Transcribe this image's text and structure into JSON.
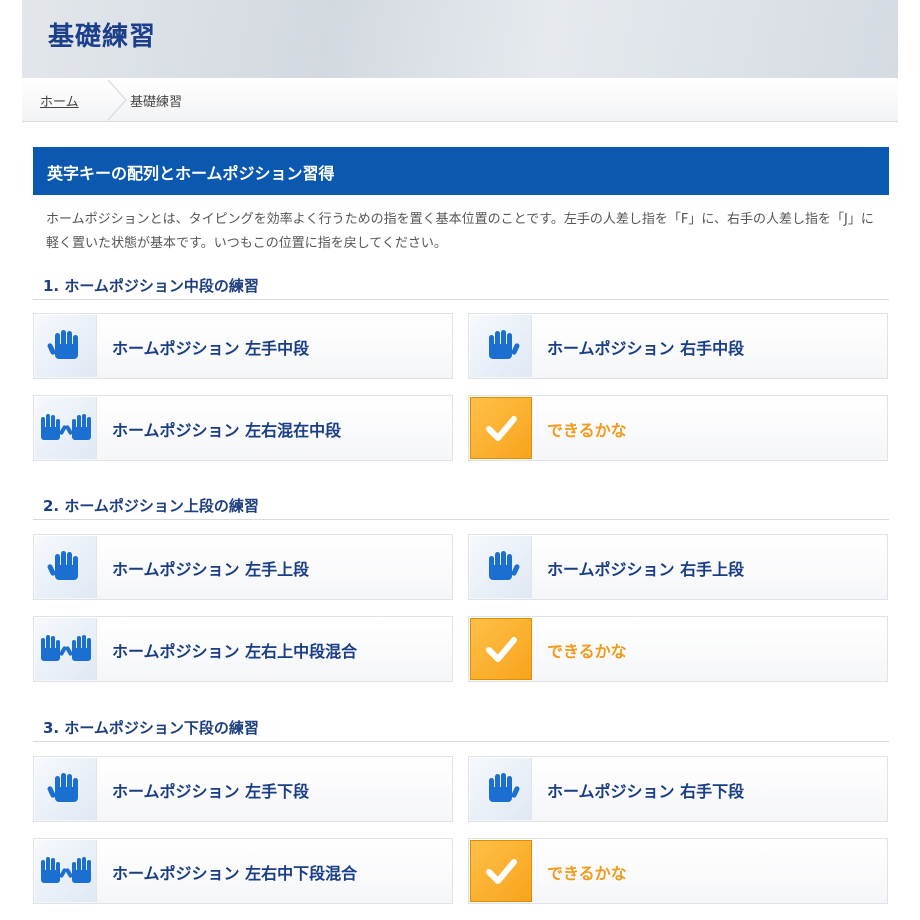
{
  "header": {
    "title": "基礎練習"
  },
  "breadcrumb": {
    "home": "ホーム",
    "current": "基礎練習"
  },
  "section": {
    "title": "英字キーの配列とホームポジション習得",
    "intro": "ホームポジションとは、タイピングを効率よく行うための指を置く基本位置のことです。左手の人差し指を「F」に、右手の人差し指を「J」に軽く置いた状態が基本です。いつもこの位置に指を戻してください。"
  },
  "groups": [
    {
      "heading": "1. ホームポジション中段の練習",
      "items": [
        {
          "label": "ホームポジション 左手中段",
          "icon": "left-hand-icon"
        },
        {
          "label": "ホームポジション 右手中段",
          "icon": "right-hand-icon"
        },
        {
          "label": "ホームポジション 左右混在中段",
          "icon": "both-hands-icon"
        },
        {
          "label": "できるかな",
          "icon": "checkmark-icon"
        }
      ]
    },
    {
      "heading": "2. ホームポジション上段の練習",
      "items": [
        {
          "label": "ホームポジション 左手上段",
          "icon": "left-hand-icon"
        },
        {
          "label": "ホームポジション 右手上段",
          "icon": "right-hand-icon"
        },
        {
          "label": "ホームポジション 左右上中段混合",
          "icon": "both-hands-icon"
        },
        {
          "label": "できるかな",
          "icon": "checkmark-icon"
        }
      ]
    },
    {
      "heading": "3. ホームポジション下段の練習",
      "items": [
        {
          "label": "ホームポジション 左手下段",
          "icon": "left-hand-icon"
        },
        {
          "label": "ホームポジション 右手下段",
          "icon": "right-hand-icon"
        },
        {
          "label": "ホームポジション 左右中下段混合",
          "icon": "both-hands-icon"
        },
        {
          "label": "できるかな",
          "icon": "checkmark-icon"
        }
      ]
    }
  ],
  "colors": {
    "header_title": "#1c3f8c",
    "section_bar": "#0a58b0",
    "hand_icon": "#1a6fd0",
    "check_bg": "#f7a41c",
    "check_label": "#f29a1a"
  }
}
